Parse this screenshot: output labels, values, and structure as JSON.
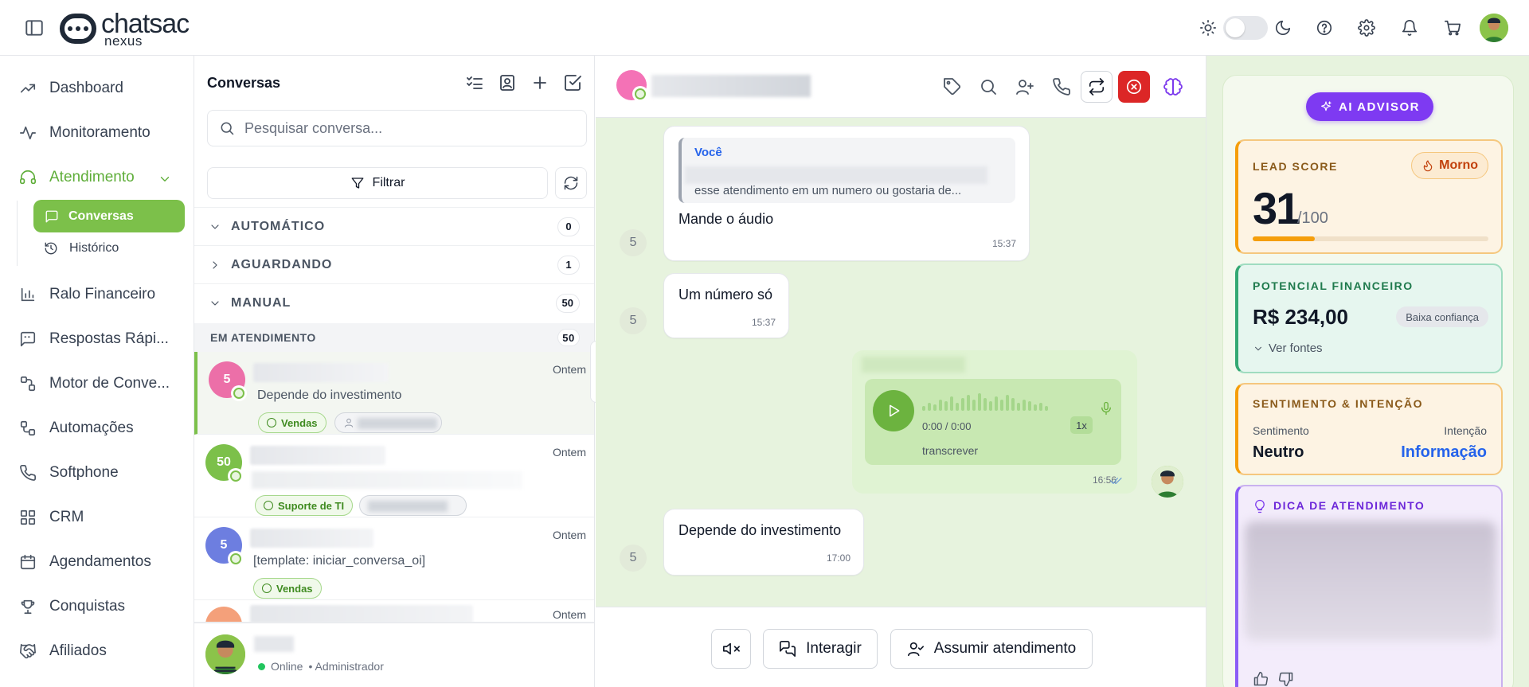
{
  "brand": {
    "name": "chatsac",
    "sub": "nexus"
  },
  "sidebar": {
    "items": [
      {
        "label": "Dashboard"
      },
      {
        "label": "Monitoramento"
      },
      {
        "label": "Atendimento"
      },
      {
        "label": "Ralo Financeiro"
      },
      {
        "label": "Respostas Rápi..."
      },
      {
        "label": "Motor de Conve..."
      },
      {
        "label": "Automações"
      },
      {
        "label": "Softphone"
      },
      {
        "label": "CRM"
      },
      {
        "label": "Agendamentos"
      },
      {
        "label": "Conquistas"
      },
      {
        "label": "Afiliados"
      }
    ],
    "sub": [
      {
        "label": "Conversas"
      },
      {
        "label": "Histórico"
      }
    ]
  },
  "conversations": {
    "title": "Conversas",
    "search_placeholder": "Pesquisar conversa...",
    "filter_label": "Filtrar",
    "groups": [
      {
        "label": "AUTOMÁTICO",
        "count": "0"
      },
      {
        "label": "AGUARDANDO",
        "count": "1"
      },
      {
        "label": "MANUAL",
        "count": "50"
      }
    ],
    "subgroup": {
      "label": "EM ATENDIMENTO",
      "count": "50"
    },
    "items": [
      {
        "avatar": "5",
        "time": "Ontem",
        "message": "Depende do investimento",
        "tag": "Vendas",
        "color": "#ec6fa8"
      },
      {
        "avatar": "50",
        "time": "Ontem",
        "message": "",
        "tag": "Suporte de TI",
        "color": "#7cc04a"
      },
      {
        "avatar": "5",
        "time": "Ontem",
        "message": "[template: iniciar_conversa_oi]",
        "tag": "Vendas",
        "color": "#6d7ee0"
      },
      {
        "avatar": "",
        "time": "Ontem",
        "message": "",
        "tag": "",
        "color": "#f4a07a"
      }
    ],
    "footer": {
      "status": "Online",
      "role": "• Administrador"
    }
  },
  "chat": {
    "messages": {
      "m1": {
        "quote_author": "Você",
        "quote_text": "esse atendimento em um numero ou gostaria de...",
        "text": "Mande o áudio",
        "time": "15:37",
        "sender": "5"
      },
      "m2": {
        "text": "Um número só",
        "time": "15:37",
        "sender": "5"
      },
      "audio": {
        "time_display": "0:00 / 0:00",
        "speed": "1x",
        "transcribe": "transcrever",
        "time": "16:56"
      },
      "m3": {
        "text": "Depende do investimento",
        "time": "17:00",
        "sender": "5"
      }
    },
    "footer": {
      "interact": "Interagir",
      "assume": "Assumir atendimento"
    }
  },
  "advisor": {
    "button": "AI ADVISOR",
    "lead": {
      "label": "LEAD SCORE",
      "badge": "Morno",
      "score": "31",
      "max": "/100",
      "fraction": 0.31
    },
    "financial": {
      "label": "POTENCIAL FINANCEIRO",
      "value": "R$ 234,00",
      "confidence": "Baixa confiança",
      "sources": "Ver fontes"
    },
    "sentiment": {
      "label": "SENTIMENTO & INTENÇÃO",
      "sent_label": "Sentimento",
      "intent_label": "Intenção",
      "sent_value": "Neutro",
      "intent_value": "Informação"
    },
    "tip": {
      "label": "DICA DE ATENDIMENTO"
    }
  },
  "colors": {
    "accent": "#7cc04a",
    "ai": "#7e3af2",
    "danger": "#dc2626"
  }
}
